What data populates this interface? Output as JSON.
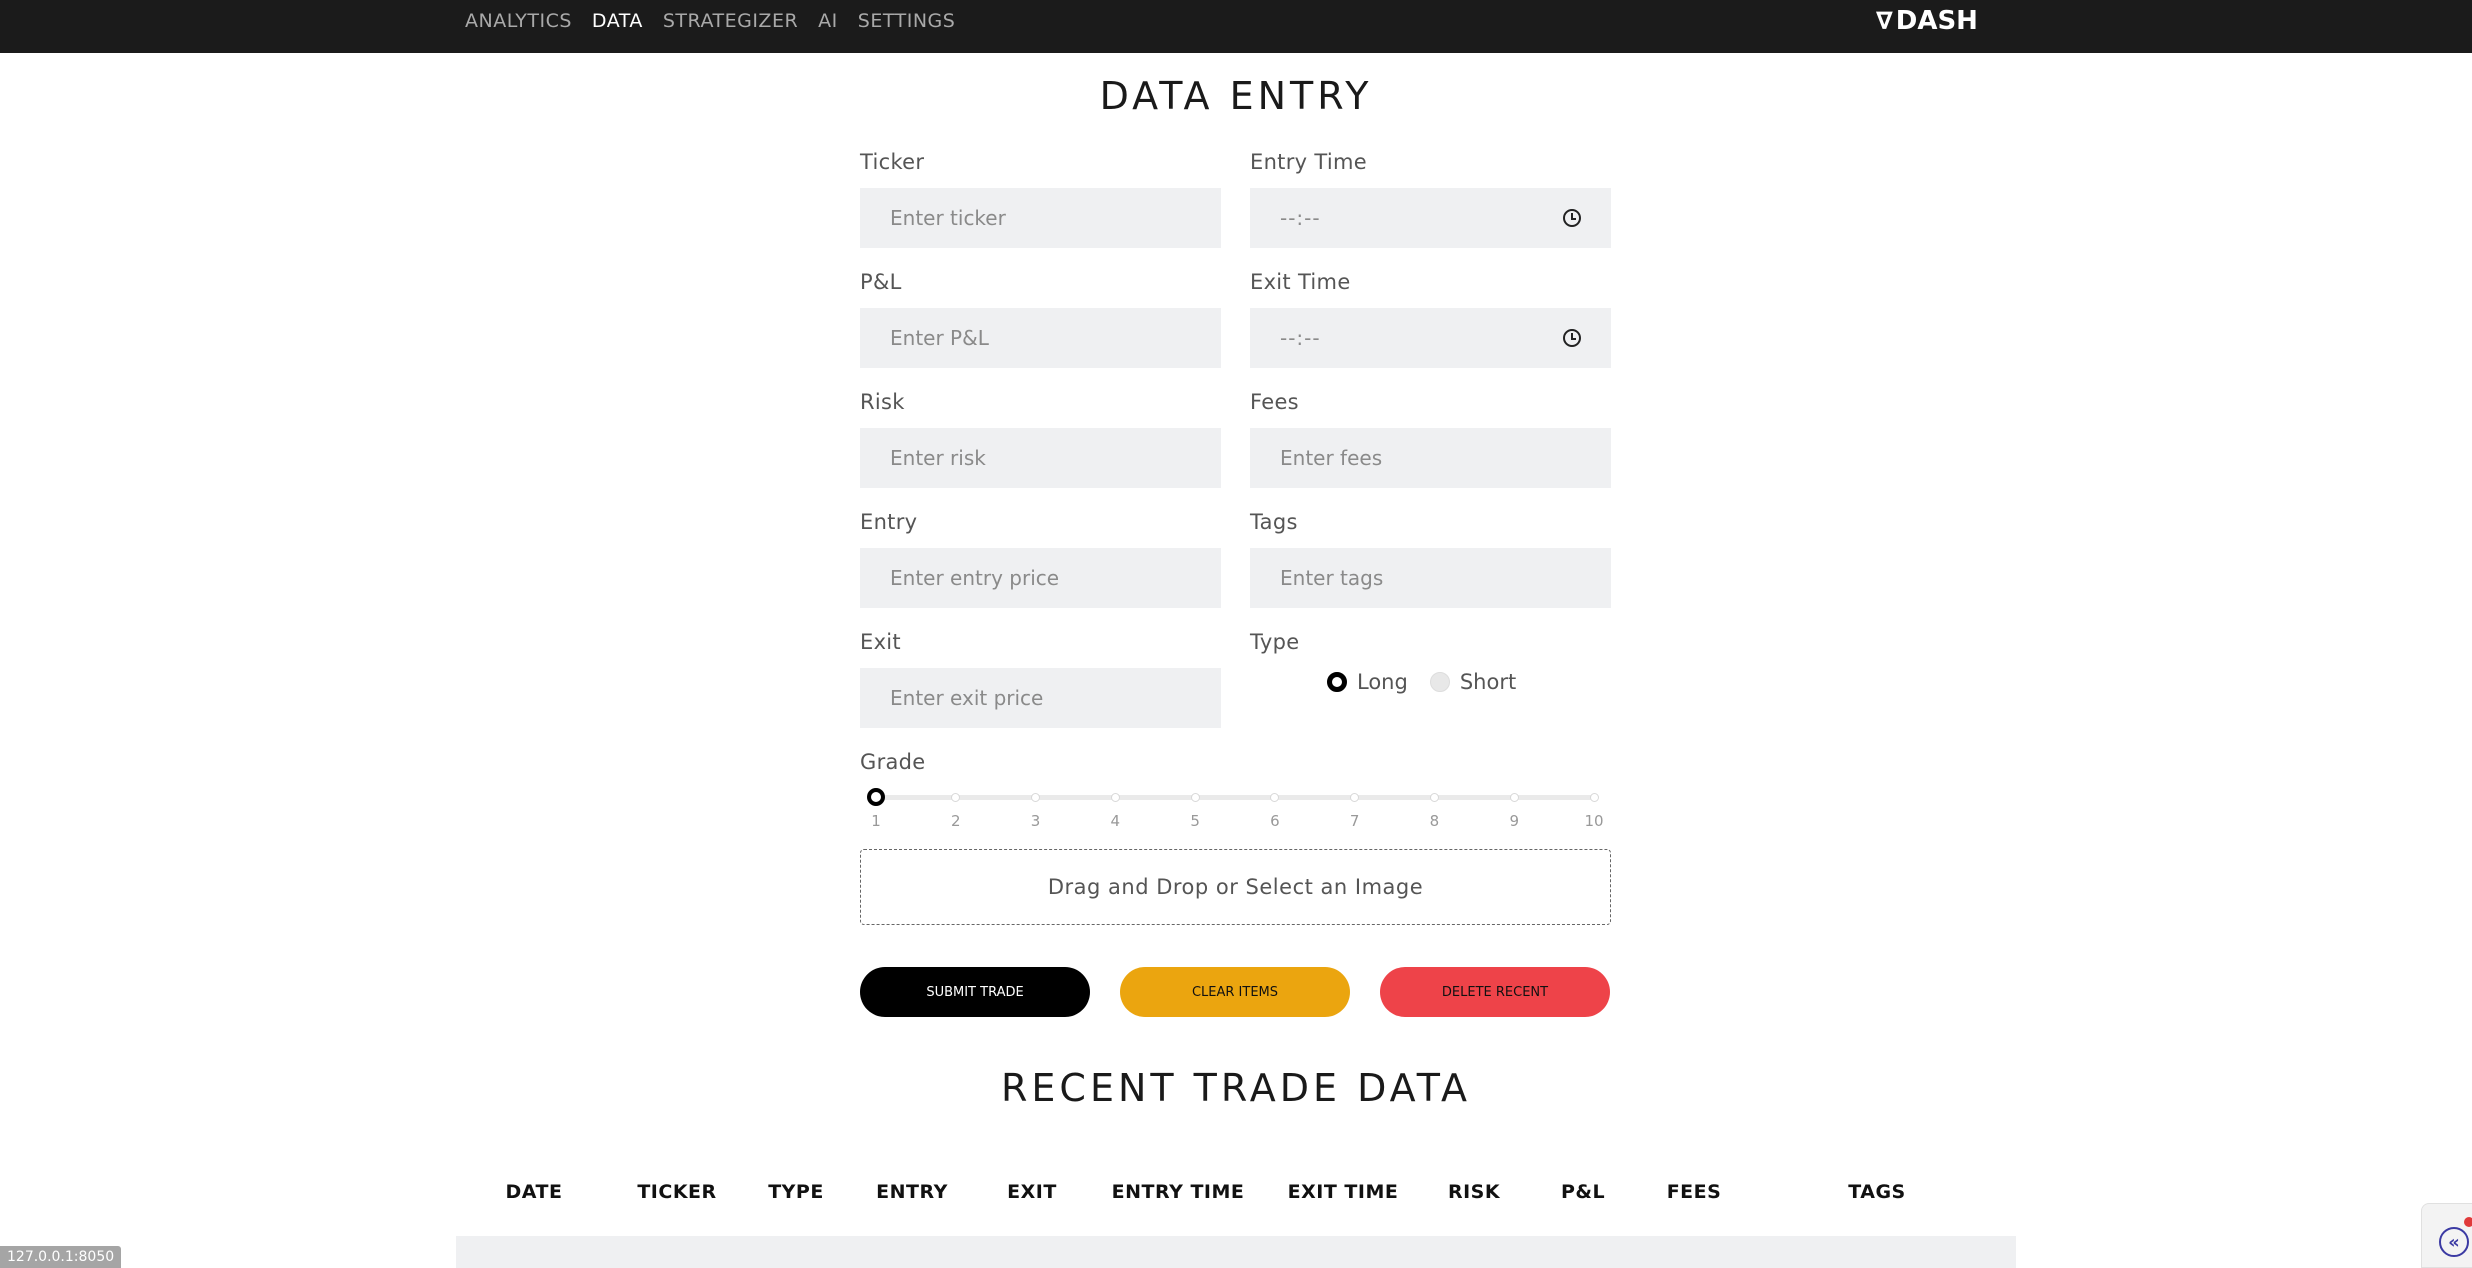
{
  "nav": {
    "items": [
      {
        "label": "ANALYTICS",
        "active": false
      },
      {
        "label": "DATA",
        "active": true
      },
      {
        "label": "STRATEGIZER",
        "active": false
      },
      {
        "label": "AI",
        "active": false
      },
      {
        "label": "SETTINGS",
        "active": false
      }
    ],
    "brand_icon": "∇",
    "brand_label": "DASH"
  },
  "data_entry": {
    "title": "DATA ENTRY",
    "ticker": {
      "label": "Ticker",
      "placeholder": "Enter ticker",
      "value": ""
    },
    "pnl": {
      "label": "P&L",
      "placeholder": "Enter P&L",
      "value": ""
    },
    "risk": {
      "label": "Risk",
      "placeholder": "Enter risk",
      "value": ""
    },
    "entry": {
      "label": "Entry",
      "placeholder": "Enter entry price",
      "value": ""
    },
    "exit": {
      "label": "Exit",
      "placeholder": "Enter exit price",
      "value": ""
    },
    "entry_time": {
      "label": "Entry Time",
      "value": "--:--"
    },
    "exit_time": {
      "label": "Exit Time",
      "value": "--:--"
    },
    "fees": {
      "label": "Fees",
      "placeholder": "Enter fees",
      "value": ""
    },
    "tags": {
      "label": "Tags",
      "placeholder": "Enter tags",
      "value": ""
    },
    "type": {
      "label": "Type",
      "options": [
        "Long",
        "Short"
      ],
      "selected": "Long"
    },
    "grade": {
      "label": "Grade",
      "min": 1,
      "max": 10,
      "value": 1,
      "marks": [
        "1",
        "2",
        "3",
        "4",
        "5",
        "6",
        "7",
        "8",
        "9",
        "10"
      ]
    },
    "dropzone_text": "Drag and Drop or Select an Image",
    "buttons": {
      "submit": "SUBMIT TRADE",
      "clear": "CLEAR ITEMS",
      "delete": "DELETE RECENT"
    }
  },
  "recent": {
    "title": "RECENT TRADE DATA",
    "columns": [
      "DATE",
      "TICKER",
      "TYPE",
      "ENTRY",
      "EXIT",
      "ENTRY TIME",
      "EXIT TIME",
      "RISK",
      "P&L",
      "FEES",
      "TAGS"
    ]
  },
  "status": {
    "url": "127.0.0.1:8050"
  },
  "colors": {
    "topbar": "#1b1b1b",
    "input_bg": "#eff0f2",
    "submit": "#000000",
    "clear": "#eba50f",
    "delete": "#ee4349"
  }
}
